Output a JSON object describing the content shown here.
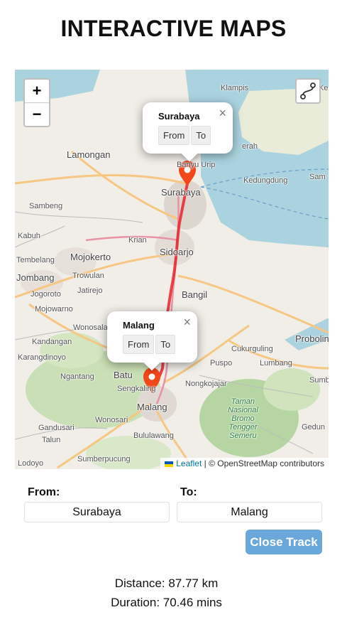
{
  "header": {
    "title": "INTERACTIVE MAPS"
  },
  "map": {
    "zoom_in": "+",
    "zoom_out": "−",
    "labels": {
      "lamongan": "Lamongan",
      "sambeng": "Sambeng",
      "kabuh": "Kabuh",
      "tembelang": "Tembelang",
      "jombang": "Jombang",
      "jogoroto": "Jogoroto",
      "mojowarno": "Mojowarno",
      "kandangan": "Kandangan",
      "karangdinoyo": "Karangdinoyo",
      "ngantang": "Ngantang",
      "gandusari": "Gandusari",
      "talun": "Talun",
      "lodoyo": "Lodoyo",
      "sumberpucung": "Sumberpucung",
      "krian": "Krian",
      "mojokerto": "Mojokerto",
      "trowulan": "Trowulan",
      "jatirejo": "Jatirejo",
      "wonosalam": "Wonosalam",
      "batu": "Batu",
      "sengkaling": "Sengkaling",
      "wonosari": "Wonosari",
      "bululawang": "Bululawang",
      "banyu_urip": "Banyu Urip",
      "surabaya": "Surabaya",
      "sidoarjo": "Sidoarjo",
      "bangil": "Bangil",
      "malang": "Malang",
      "klampis": "Klampis",
      "kedungdung": "Kedungdung",
      "sam": "Sam",
      "erah": "erah",
      "probolinggo": "Probolinggo",
      "cukurguling": "Cukurguling",
      "puspo": "Puspo",
      "lumbang": "Lumbang",
      "nongkojajar": "Nongkojajar",
      "sumber": "Sumber",
      "gedung": "Gedun",
      "bromo": "Taman\nNasional\nBromo\nTengger\nSemeru",
      "ke": "Ke"
    },
    "popups": {
      "surabaya": {
        "title": "Surabaya",
        "from": "From",
        "to": "To",
        "close": "×"
      },
      "malang": {
        "title": "Malang",
        "from": "From",
        "to": "To",
        "close": "×"
      }
    },
    "attribution": {
      "link": "Leaflet",
      "text": "| © OpenStreetMap contributors"
    },
    "colors": {
      "route": "#e8232c",
      "marker": "#f2461b",
      "water": "#aad3df"
    }
  },
  "form": {
    "from_label": "From:",
    "to_label": "To:",
    "from_value": "Surabaya",
    "to_value": "Malang",
    "close_track": "Close Track"
  },
  "stats": {
    "distance": "Distance: 87.77 km",
    "duration": "Duration: 70.46 mins"
  }
}
